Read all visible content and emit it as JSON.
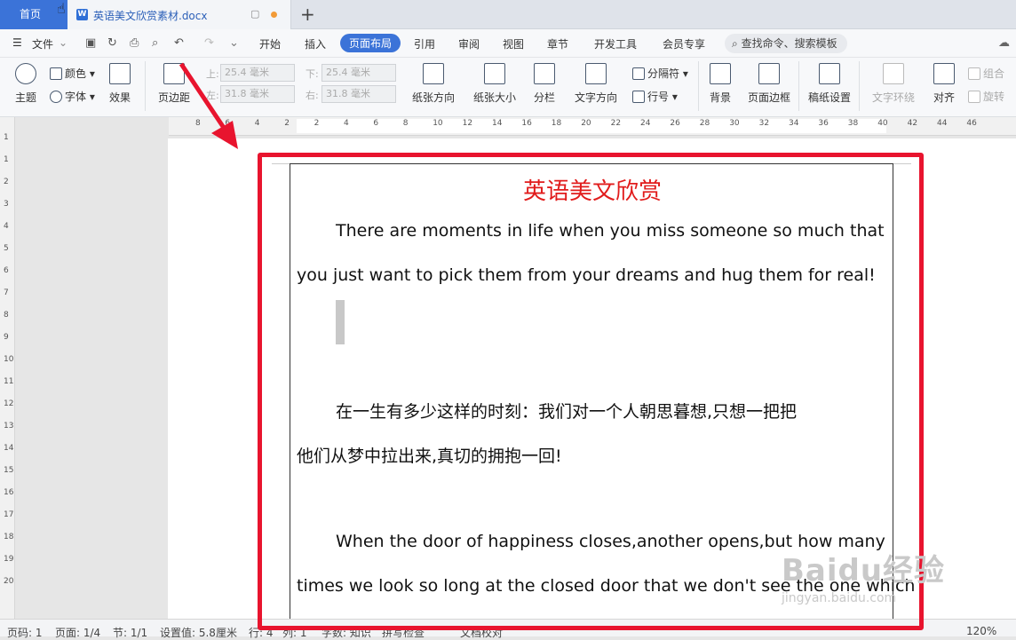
{
  "tabs": {
    "home": "首页",
    "doc_title": "英语美文欣赏素材.docx",
    "new_tab": "+"
  },
  "menubar": {
    "file": "文件",
    "items": [
      "开始",
      "插入",
      "页面布局",
      "引用",
      "审阅",
      "视图",
      "章节",
      "开发工具",
      "会员专享"
    ],
    "active": "页面布局",
    "search": "查找命令、搜索模板"
  },
  "ribbon": {
    "theme": "主题",
    "color": "颜色",
    "font": "字体",
    "effect": "效果",
    "margins": "页边距",
    "top_label": "上:",
    "bottom_label": "下:",
    "left_label": "左:",
    "right_label": "右:",
    "top_value": "25.4 毫米",
    "bottom_value": "25.4 毫米",
    "left_value": "31.8 毫米",
    "right_value": "31.8 毫米",
    "orientation": "纸张方向",
    "size": "纸张大小",
    "columns": "分栏",
    "text_direction": "文字方向",
    "separator": "分隔符",
    "line_number": "行号",
    "background": "背景",
    "page_border": "页面边框",
    "paper_settings": "稿纸设置",
    "text_wrap": "文字环绕",
    "align": "对齐",
    "group": "组合",
    "rotate": "旋转"
  },
  "ruler": {
    "h_labels": [
      "8",
      "6",
      "4",
      "2",
      "2",
      "4",
      "6",
      "8",
      "10",
      "12",
      "14",
      "16",
      "18",
      "20",
      "22",
      "24",
      "26",
      "28",
      "30",
      "32",
      "34",
      "36",
      "38",
      "40",
      "42",
      "44",
      "46"
    ],
    "v_labels": [
      "1",
      "1",
      "2",
      "3",
      "4",
      "5",
      "6",
      "7",
      "8",
      "9",
      "10",
      "11",
      "12",
      "13",
      "14",
      "15",
      "16",
      "17",
      "18",
      "19",
      "20"
    ]
  },
  "document": {
    "heading": "英语美文欣赏",
    "p1_l1": "There are moments in life when you miss someone so much that",
    "p1_l2": "you just want to pick them from your dreams and hug them for real!",
    "p2_l1": "在一生有多少这样的时刻：我们对一个人朝思暮想,只想一把把",
    "p2_l2": "他们从梦中拉出来,真切的拥抱一回!",
    "p3_l1": "When the door of happiness closes,another opens,but how many",
    "p3_l2": "times we look so long at the closed door that we don't see the one which"
  },
  "statusbar": {
    "page": "页码: 1",
    "pages": "页面: 1/4",
    "section": "节: 1/1",
    "setting": "设置值: 5.8厘米",
    "row": "行: 4",
    "col": "列: 1",
    "words": "字数: 知识",
    "spell": "拼写检查",
    "doc_check": "文档校对",
    "zoom": "120%"
  },
  "watermark": {
    "brand": "Baidu经验",
    "url": "jingyan.baidu.com"
  },
  "colors": {
    "accent": "#3b73d8",
    "highlight": "#e8142e",
    "heading": "#e11c1c"
  }
}
